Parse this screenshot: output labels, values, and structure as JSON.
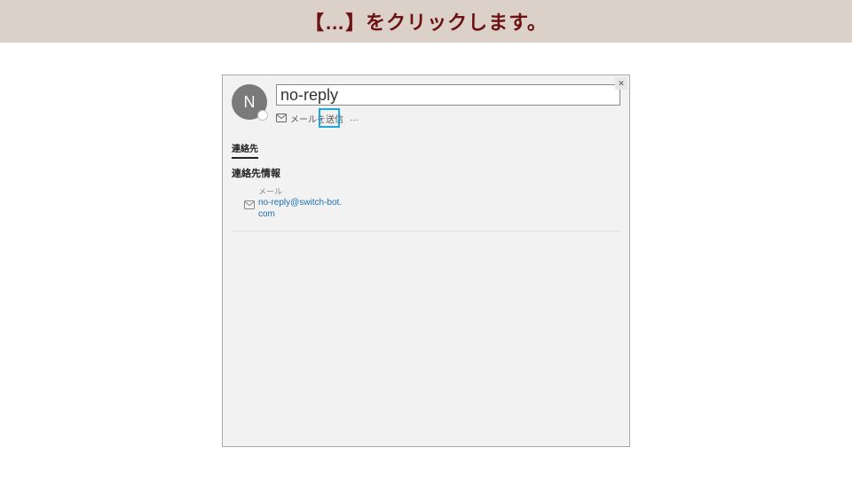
{
  "banner": {
    "text": "【…】をクリックします。"
  },
  "window": {
    "close_label": "✕",
    "avatar_initial": "N",
    "contact_name": "no-reply",
    "actions": {
      "send_mail_label": "メールを送信",
      "more_label": "…"
    },
    "tabs": {
      "contact": "連絡先"
    },
    "section_title": "連絡先情報",
    "mail_field": {
      "label": "メール",
      "value": "no-reply@switch-bot.com"
    }
  }
}
